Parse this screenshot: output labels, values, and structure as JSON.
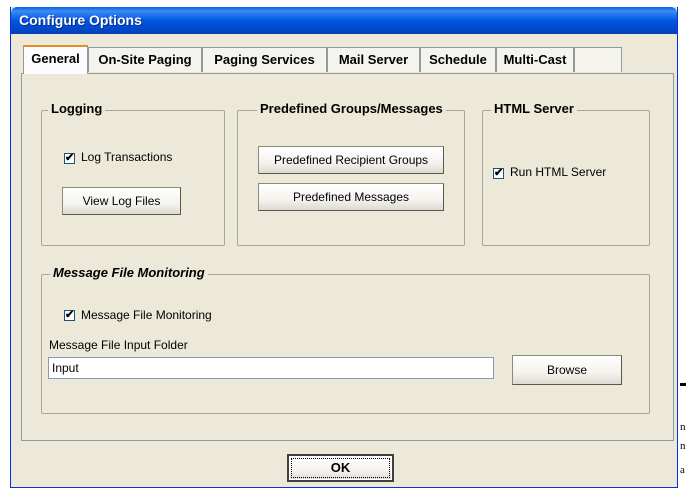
{
  "window": {
    "title": "Configure Options"
  },
  "tabs": [
    {
      "label": "General",
      "active": true
    },
    {
      "label": "On-Site Paging"
    },
    {
      "label": "Paging Services"
    },
    {
      "label": "Mail Server"
    },
    {
      "label": "Schedule"
    },
    {
      "label": "Multi-Cast"
    },
    {
      "label": ""
    }
  ],
  "logging": {
    "legend": "Logging",
    "log_transactions_label": "Log Transactions",
    "log_transactions_checked": true,
    "view_log_files_label": "View Log Files"
  },
  "predefined": {
    "legend": "Predefined Groups/Messages",
    "recipient_groups_label": "Predefined Recipient Groups",
    "messages_label": "Predefined Messages"
  },
  "html_server": {
    "legend": "HTML Server",
    "run_label": "Run HTML Server",
    "run_checked": true
  },
  "message_monitoring": {
    "legend": "Message File Monitoring",
    "checkbox_label": "Message File Monitoring",
    "checkbox_checked": true,
    "folder_label": "Message File Input Folder",
    "folder_value": "Input",
    "browse_label": "Browse"
  },
  "footer": {
    "ok_label": "OK"
  },
  "background_text": [
    "n",
    "n",
    "a"
  ]
}
